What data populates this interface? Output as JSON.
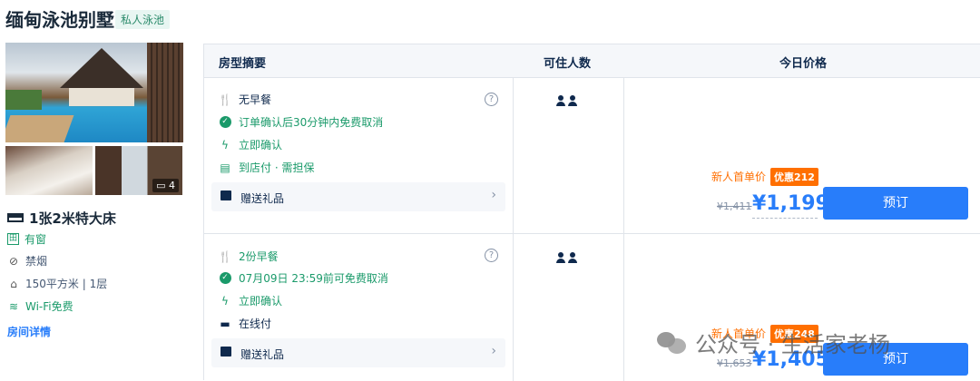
{
  "hotel": {
    "title": "缅甸泳池别墅",
    "tag": "私人泳池"
  },
  "gallery": {
    "photo_count": "4"
  },
  "room": {
    "name": "1张2米特大床",
    "features": [
      {
        "icon": "window-icon",
        "label": "有窗",
        "color": "#1a9a6a"
      },
      {
        "icon": "no-smoking-icon",
        "label": "禁烟",
        "color": "#455873"
      },
      {
        "icon": "area-icon",
        "label": "150平方米 | 1层",
        "color": "#455873"
      },
      {
        "icon": "wifi-icon",
        "label": "Wi-Fi免费",
        "color": "#1a9a6a"
      }
    ],
    "detail_link": "房间详情"
  },
  "table": {
    "headers": {
      "summary": "房型摘要",
      "occupancy": "可住人数",
      "price": "今日价格"
    },
    "rows": [
      {
        "lines": [
          {
            "icon": "no-meal-icon",
            "text": "无早餐",
            "color": "#0f294d"
          },
          {
            "icon": "check-circle-icon",
            "text": "订单确认后30分钟内免费取消",
            "color": "#1a9a6a"
          },
          {
            "icon": "lightning-icon",
            "text": "立即确认",
            "color": "#1a9a6a"
          },
          {
            "icon": "pay-at-hotel-icon",
            "text": "到店付 · 需担保",
            "color": "#1a9a6a"
          }
        ],
        "gift": "赠送礼品",
        "promo_label": "新人首单价",
        "promo_tag": "优惠212",
        "old_price": "¥1,411",
        "price": "¥1,199",
        "book": "预订"
      },
      {
        "lines": [
          {
            "icon": "meal-icon",
            "text": "2份早餐",
            "color": "#1a9a6a"
          },
          {
            "icon": "check-circle-icon",
            "text": "07月09日 23:59前可免费取消",
            "color": "#1a9a6a"
          },
          {
            "icon": "lightning-icon",
            "text": "立即确认",
            "color": "#1a9a6a"
          },
          {
            "icon": "card-icon",
            "text": "在线付",
            "color": "#0f294d"
          }
        ],
        "gift": "赠送礼品",
        "promo_label": "新人首单价",
        "promo_tag": "优惠248",
        "old_price": "¥1,653",
        "price": "¥1,405",
        "book": "预订"
      }
    ]
  },
  "watermark": "公众号 · 生活家老杨",
  "colors": {
    "accent": "#287dfa",
    "green": "#1a9a6a",
    "orange": "#ff6f00"
  }
}
